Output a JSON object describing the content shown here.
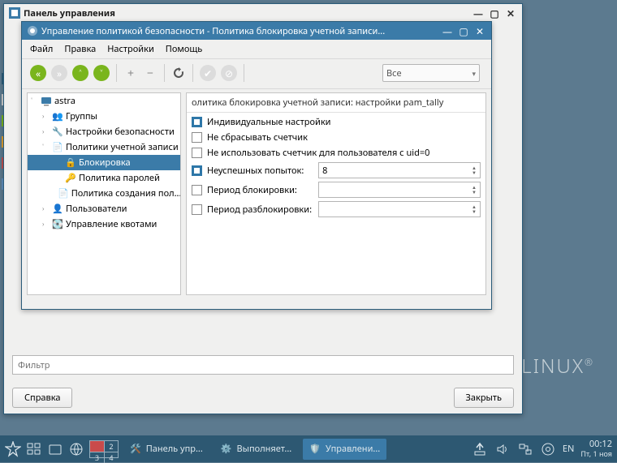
{
  "outer_window": {
    "title": "Панель управления",
    "filter_placeholder": "Фильтр",
    "btn_help": "Справка",
    "btn_close": "Закрыть"
  },
  "inner_window": {
    "title": "Управление политикой безопасности - Политика блокировка учетной записи...",
    "menu": {
      "file": "Файл",
      "edit": "Правка",
      "settings": "Настройки",
      "help": "Помощь"
    },
    "toolbar": {
      "filter_label": "Все"
    },
    "tree": {
      "root": "astra",
      "items": [
        "Группы",
        "Настройки безопасности",
        "Политики учетной записи",
        "Блокировка",
        "Политика паролей",
        "Политика создания пол...",
        "Пользователи",
        "Управление квотами"
      ]
    },
    "panel": {
      "title": "олитика блокировка учетной записи: настройки pam_tally",
      "opt_individual": "Индивидуальные настройки",
      "opt_noreset": "Не сбрасывать счетчик",
      "opt_uid0": "Не использовать счетчик для пользователя с uid=0",
      "lbl_fail": "Неуспешных попыток:",
      "val_fail": "8",
      "lbl_lock": "Период блокировки:",
      "val_lock": "",
      "lbl_unlock": "Период разблокировки:",
      "val_unlock": ""
    }
  },
  "taskbar": {
    "tasks": [
      "Панель упр...",
      "Выполняет...",
      "Управлени..."
    ],
    "lang": "EN",
    "time": "00:12",
    "date": "Пт, 1 ноя"
  },
  "brand": "LINUX"
}
